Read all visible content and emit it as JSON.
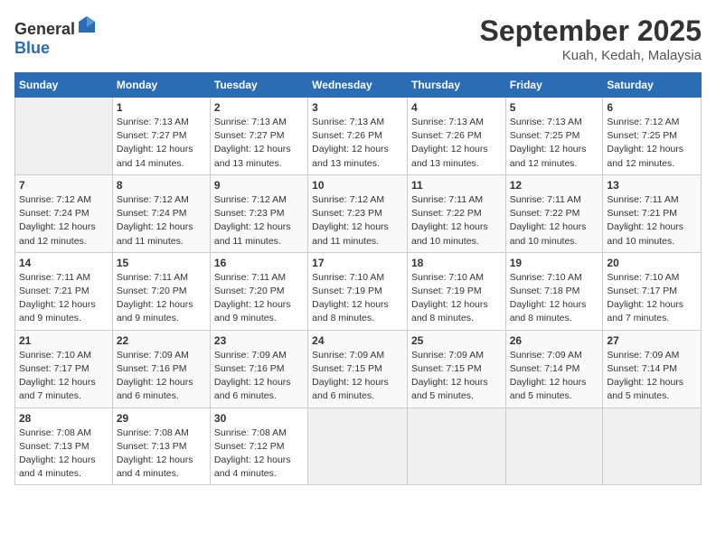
{
  "header": {
    "logo_general": "General",
    "logo_blue": "Blue",
    "month": "September 2025",
    "location": "Kuah, Kedah, Malaysia"
  },
  "days_of_week": [
    "Sunday",
    "Monday",
    "Tuesday",
    "Wednesday",
    "Thursday",
    "Friday",
    "Saturday"
  ],
  "weeks": [
    [
      {
        "day": "",
        "empty": true
      },
      {
        "day": "1",
        "sunrise": "7:13 AM",
        "sunset": "7:27 PM",
        "daylight": "12 hours and 14 minutes."
      },
      {
        "day": "2",
        "sunrise": "7:13 AM",
        "sunset": "7:27 PM",
        "daylight": "12 hours and 13 minutes."
      },
      {
        "day": "3",
        "sunrise": "7:13 AM",
        "sunset": "7:26 PM",
        "daylight": "12 hours and 13 minutes."
      },
      {
        "day": "4",
        "sunrise": "7:13 AM",
        "sunset": "7:26 PM",
        "daylight": "12 hours and 13 minutes."
      },
      {
        "day": "5",
        "sunrise": "7:13 AM",
        "sunset": "7:25 PM",
        "daylight": "12 hours and 12 minutes."
      },
      {
        "day": "6",
        "sunrise": "7:12 AM",
        "sunset": "7:25 PM",
        "daylight": "12 hours and 12 minutes."
      }
    ],
    [
      {
        "day": "7",
        "sunrise": "7:12 AM",
        "sunset": "7:24 PM",
        "daylight": "12 hours and 12 minutes."
      },
      {
        "day": "8",
        "sunrise": "7:12 AM",
        "sunset": "7:24 PM",
        "daylight": "12 hours and 11 minutes."
      },
      {
        "day": "9",
        "sunrise": "7:12 AM",
        "sunset": "7:23 PM",
        "daylight": "12 hours and 11 minutes."
      },
      {
        "day": "10",
        "sunrise": "7:12 AM",
        "sunset": "7:23 PM",
        "daylight": "12 hours and 11 minutes."
      },
      {
        "day": "11",
        "sunrise": "7:11 AM",
        "sunset": "7:22 PM",
        "daylight": "12 hours and 10 minutes."
      },
      {
        "day": "12",
        "sunrise": "7:11 AM",
        "sunset": "7:22 PM",
        "daylight": "12 hours and 10 minutes."
      },
      {
        "day": "13",
        "sunrise": "7:11 AM",
        "sunset": "7:21 PM",
        "daylight": "12 hours and 10 minutes."
      }
    ],
    [
      {
        "day": "14",
        "sunrise": "7:11 AM",
        "sunset": "7:21 PM",
        "daylight": "12 hours and 9 minutes."
      },
      {
        "day": "15",
        "sunrise": "7:11 AM",
        "sunset": "7:20 PM",
        "daylight": "12 hours and 9 minutes."
      },
      {
        "day": "16",
        "sunrise": "7:11 AM",
        "sunset": "7:20 PM",
        "daylight": "12 hours and 9 minutes."
      },
      {
        "day": "17",
        "sunrise": "7:10 AM",
        "sunset": "7:19 PM",
        "daylight": "12 hours and 8 minutes."
      },
      {
        "day": "18",
        "sunrise": "7:10 AM",
        "sunset": "7:19 PM",
        "daylight": "12 hours and 8 minutes."
      },
      {
        "day": "19",
        "sunrise": "7:10 AM",
        "sunset": "7:18 PM",
        "daylight": "12 hours and 8 minutes."
      },
      {
        "day": "20",
        "sunrise": "7:10 AM",
        "sunset": "7:17 PM",
        "daylight": "12 hours and 7 minutes."
      }
    ],
    [
      {
        "day": "21",
        "sunrise": "7:10 AM",
        "sunset": "7:17 PM",
        "daylight": "12 hours and 7 minutes."
      },
      {
        "day": "22",
        "sunrise": "7:09 AM",
        "sunset": "7:16 PM",
        "daylight": "12 hours and 6 minutes."
      },
      {
        "day": "23",
        "sunrise": "7:09 AM",
        "sunset": "7:16 PM",
        "daylight": "12 hours and 6 minutes."
      },
      {
        "day": "24",
        "sunrise": "7:09 AM",
        "sunset": "7:15 PM",
        "daylight": "12 hours and 6 minutes."
      },
      {
        "day": "25",
        "sunrise": "7:09 AM",
        "sunset": "7:15 PM",
        "daylight": "12 hours and 5 minutes."
      },
      {
        "day": "26",
        "sunrise": "7:09 AM",
        "sunset": "7:14 PM",
        "daylight": "12 hours and 5 minutes."
      },
      {
        "day": "27",
        "sunrise": "7:09 AM",
        "sunset": "7:14 PM",
        "daylight": "12 hours and 5 minutes."
      }
    ],
    [
      {
        "day": "28",
        "sunrise": "7:08 AM",
        "sunset": "7:13 PM",
        "daylight": "12 hours and 4 minutes."
      },
      {
        "day": "29",
        "sunrise": "7:08 AM",
        "sunset": "7:13 PM",
        "daylight": "12 hours and 4 minutes."
      },
      {
        "day": "30",
        "sunrise": "7:08 AM",
        "sunset": "7:12 PM",
        "daylight": "12 hours and 4 minutes."
      },
      {
        "day": "",
        "empty": true
      },
      {
        "day": "",
        "empty": true
      },
      {
        "day": "",
        "empty": true
      },
      {
        "day": "",
        "empty": true
      }
    ]
  ],
  "labels": {
    "sunrise": "Sunrise:",
    "sunset": "Sunset:",
    "daylight": "Daylight:"
  }
}
